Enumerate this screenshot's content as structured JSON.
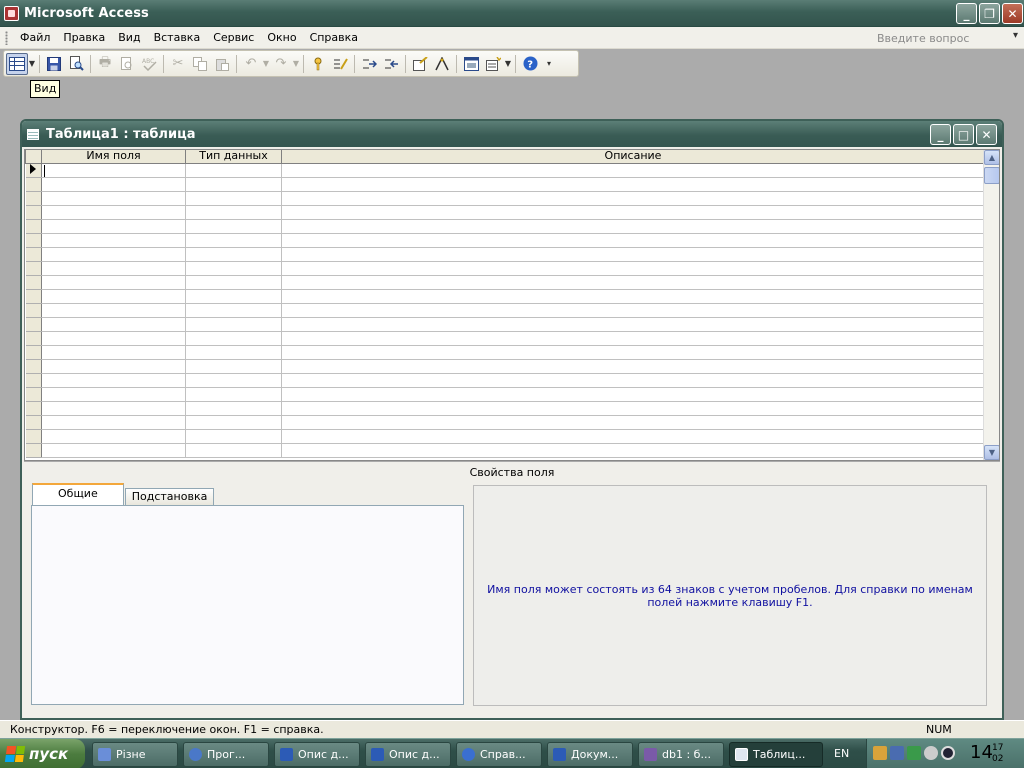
{
  "app": {
    "title": "Microsoft Access",
    "min_label": "_",
    "restore_label": "❐",
    "close_label": "✕"
  },
  "menu": {
    "items": [
      {
        "label": "Файл"
      },
      {
        "label": "Правка"
      },
      {
        "label": "Вид"
      },
      {
        "label": "Вставка"
      },
      {
        "label": "Сервис"
      },
      {
        "label": "Окно"
      },
      {
        "label": "Справка"
      }
    ],
    "help_placeholder": "Введите вопрос"
  },
  "tooltip": {
    "text": "Вид"
  },
  "doc_window": {
    "title": "Таблица1 : таблица",
    "min_label": "_",
    "max_label": "□",
    "close_label": "✕"
  },
  "grid": {
    "headers": [
      "Имя поля",
      "Тип данных",
      "Описание"
    ],
    "row_count": 21
  },
  "properties": {
    "label": "Свойства поля",
    "tabs": [
      {
        "label": "Общие",
        "active": true
      },
      {
        "label": "Подстановка",
        "active": false
      }
    ],
    "hint": "Имя поля может состоять из 64 знаков с учетом пробелов.  Для справки по именам полей нажмите клавишу F1."
  },
  "status": {
    "text": "Конструктор.  F6 = переключение окон.  F1 = справка.",
    "num": "NUM"
  },
  "taskbar": {
    "start_label": "пуск",
    "buttons": [
      {
        "label": "Різне",
        "color": "#6a8ed8"
      },
      {
        "label": "Прог...",
        "color": "#4a78c8"
      },
      {
        "label": "Опис д...",
        "color": "#2c5bb6"
      },
      {
        "label": "Опис д...",
        "color": "#2c5bb6"
      },
      {
        "label": "Справ...",
        "color": "#3a6fd0"
      },
      {
        "label": "Докум...",
        "color": "#2c5bb6"
      },
      {
        "label": "db1 : б...",
        "color": "#7a5aa8"
      },
      {
        "label": "Таблиц...",
        "color": "#7a5aa8",
        "active": true
      }
    ],
    "lang": "EN",
    "clock_hour": "14",
    "clock_min_top": "17",
    "clock_min_bottom": "02"
  }
}
